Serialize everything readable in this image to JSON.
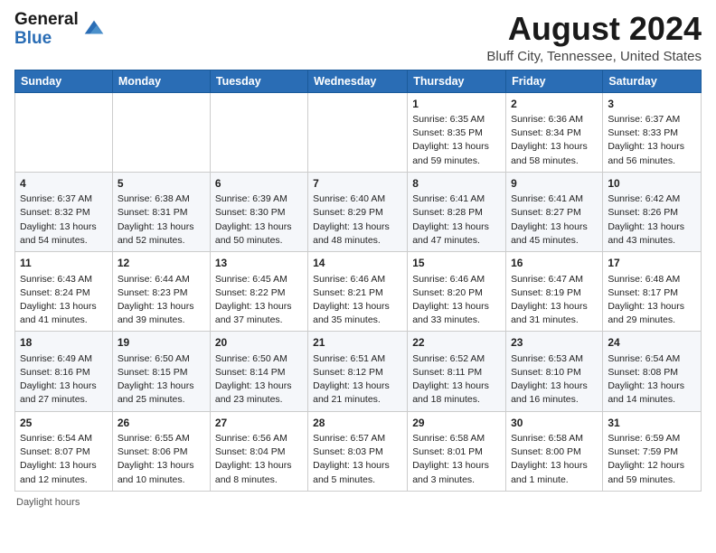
{
  "header": {
    "logo_general": "General",
    "logo_blue": "Blue",
    "main_title": "August 2024",
    "sub_title": "Bluff City, Tennessee, United States"
  },
  "weekdays": [
    "Sunday",
    "Monday",
    "Tuesday",
    "Wednesday",
    "Thursday",
    "Friday",
    "Saturday"
  ],
  "footer": {
    "daylight_label": "Daylight hours"
  },
  "weeks": [
    [
      {
        "day": "",
        "sunrise": "",
        "sunset": "",
        "daylight": ""
      },
      {
        "day": "",
        "sunrise": "",
        "sunset": "",
        "daylight": ""
      },
      {
        "day": "",
        "sunrise": "",
        "sunset": "",
        "daylight": ""
      },
      {
        "day": "",
        "sunrise": "",
        "sunset": "",
        "daylight": ""
      },
      {
        "day": "1",
        "sunrise": "Sunrise: 6:35 AM",
        "sunset": "Sunset: 8:35 PM",
        "daylight": "Daylight: 13 hours and 59 minutes."
      },
      {
        "day": "2",
        "sunrise": "Sunrise: 6:36 AM",
        "sunset": "Sunset: 8:34 PM",
        "daylight": "Daylight: 13 hours and 58 minutes."
      },
      {
        "day": "3",
        "sunrise": "Sunrise: 6:37 AM",
        "sunset": "Sunset: 8:33 PM",
        "daylight": "Daylight: 13 hours and 56 minutes."
      }
    ],
    [
      {
        "day": "4",
        "sunrise": "Sunrise: 6:37 AM",
        "sunset": "Sunset: 8:32 PM",
        "daylight": "Daylight: 13 hours and 54 minutes."
      },
      {
        "day": "5",
        "sunrise": "Sunrise: 6:38 AM",
        "sunset": "Sunset: 8:31 PM",
        "daylight": "Daylight: 13 hours and 52 minutes."
      },
      {
        "day": "6",
        "sunrise": "Sunrise: 6:39 AM",
        "sunset": "Sunset: 8:30 PM",
        "daylight": "Daylight: 13 hours and 50 minutes."
      },
      {
        "day": "7",
        "sunrise": "Sunrise: 6:40 AM",
        "sunset": "Sunset: 8:29 PM",
        "daylight": "Daylight: 13 hours and 48 minutes."
      },
      {
        "day": "8",
        "sunrise": "Sunrise: 6:41 AM",
        "sunset": "Sunset: 8:28 PM",
        "daylight": "Daylight: 13 hours and 47 minutes."
      },
      {
        "day": "9",
        "sunrise": "Sunrise: 6:41 AM",
        "sunset": "Sunset: 8:27 PM",
        "daylight": "Daylight: 13 hours and 45 minutes."
      },
      {
        "day": "10",
        "sunrise": "Sunrise: 6:42 AM",
        "sunset": "Sunset: 8:26 PM",
        "daylight": "Daylight: 13 hours and 43 minutes."
      }
    ],
    [
      {
        "day": "11",
        "sunrise": "Sunrise: 6:43 AM",
        "sunset": "Sunset: 8:24 PM",
        "daylight": "Daylight: 13 hours and 41 minutes."
      },
      {
        "day": "12",
        "sunrise": "Sunrise: 6:44 AM",
        "sunset": "Sunset: 8:23 PM",
        "daylight": "Daylight: 13 hours and 39 minutes."
      },
      {
        "day": "13",
        "sunrise": "Sunrise: 6:45 AM",
        "sunset": "Sunset: 8:22 PM",
        "daylight": "Daylight: 13 hours and 37 minutes."
      },
      {
        "day": "14",
        "sunrise": "Sunrise: 6:46 AM",
        "sunset": "Sunset: 8:21 PM",
        "daylight": "Daylight: 13 hours and 35 minutes."
      },
      {
        "day": "15",
        "sunrise": "Sunrise: 6:46 AM",
        "sunset": "Sunset: 8:20 PM",
        "daylight": "Daylight: 13 hours and 33 minutes."
      },
      {
        "day": "16",
        "sunrise": "Sunrise: 6:47 AM",
        "sunset": "Sunset: 8:19 PM",
        "daylight": "Daylight: 13 hours and 31 minutes."
      },
      {
        "day": "17",
        "sunrise": "Sunrise: 6:48 AM",
        "sunset": "Sunset: 8:17 PM",
        "daylight": "Daylight: 13 hours and 29 minutes."
      }
    ],
    [
      {
        "day": "18",
        "sunrise": "Sunrise: 6:49 AM",
        "sunset": "Sunset: 8:16 PM",
        "daylight": "Daylight: 13 hours and 27 minutes."
      },
      {
        "day": "19",
        "sunrise": "Sunrise: 6:50 AM",
        "sunset": "Sunset: 8:15 PM",
        "daylight": "Daylight: 13 hours and 25 minutes."
      },
      {
        "day": "20",
        "sunrise": "Sunrise: 6:50 AM",
        "sunset": "Sunset: 8:14 PM",
        "daylight": "Daylight: 13 hours and 23 minutes."
      },
      {
        "day": "21",
        "sunrise": "Sunrise: 6:51 AM",
        "sunset": "Sunset: 8:12 PM",
        "daylight": "Daylight: 13 hours and 21 minutes."
      },
      {
        "day": "22",
        "sunrise": "Sunrise: 6:52 AM",
        "sunset": "Sunset: 8:11 PM",
        "daylight": "Daylight: 13 hours and 18 minutes."
      },
      {
        "day": "23",
        "sunrise": "Sunrise: 6:53 AM",
        "sunset": "Sunset: 8:10 PM",
        "daylight": "Daylight: 13 hours and 16 minutes."
      },
      {
        "day": "24",
        "sunrise": "Sunrise: 6:54 AM",
        "sunset": "Sunset: 8:08 PM",
        "daylight": "Daylight: 13 hours and 14 minutes."
      }
    ],
    [
      {
        "day": "25",
        "sunrise": "Sunrise: 6:54 AM",
        "sunset": "Sunset: 8:07 PM",
        "daylight": "Daylight: 13 hours and 12 minutes."
      },
      {
        "day": "26",
        "sunrise": "Sunrise: 6:55 AM",
        "sunset": "Sunset: 8:06 PM",
        "daylight": "Daylight: 13 hours and 10 minutes."
      },
      {
        "day": "27",
        "sunrise": "Sunrise: 6:56 AM",
        "sunset": "Sunset: 8:04 PM",
        "daylight": "Daylight: 13 hours and 8 minutes."
      },
      {
        "day": "28",
        "sunrise": "Sunrise: 6:57 AM",
        "sunset": "Sunset: 8:03 PM",
        "daylight": "Daylight: 13 hours and 5 minutes."
      },
      {
        "day": "29",
        "sunrise": "Sunrise: 6:58 AM",
        "sunset": "Sunset: 8:01 PM",
        "daylight": "Daylight: 13 hours and 3 minutes."
      },
      {
        "day": "30",
        "sunrise": "Sunrise: 6:58 AM",
        "sunset": "Sunset: 8:00 PM",
        "daylight": "Daylight: 13 hours and 1 minute."
      },
      {
        "day": "31",
        "sunrise": "Sunrise: 6:59 AM",
        "sunset": "Sunset: 7:59 PM",
        "daylight": "Daylight: 12 hours and 59 minutes."
      }
    ]
  ]
}
